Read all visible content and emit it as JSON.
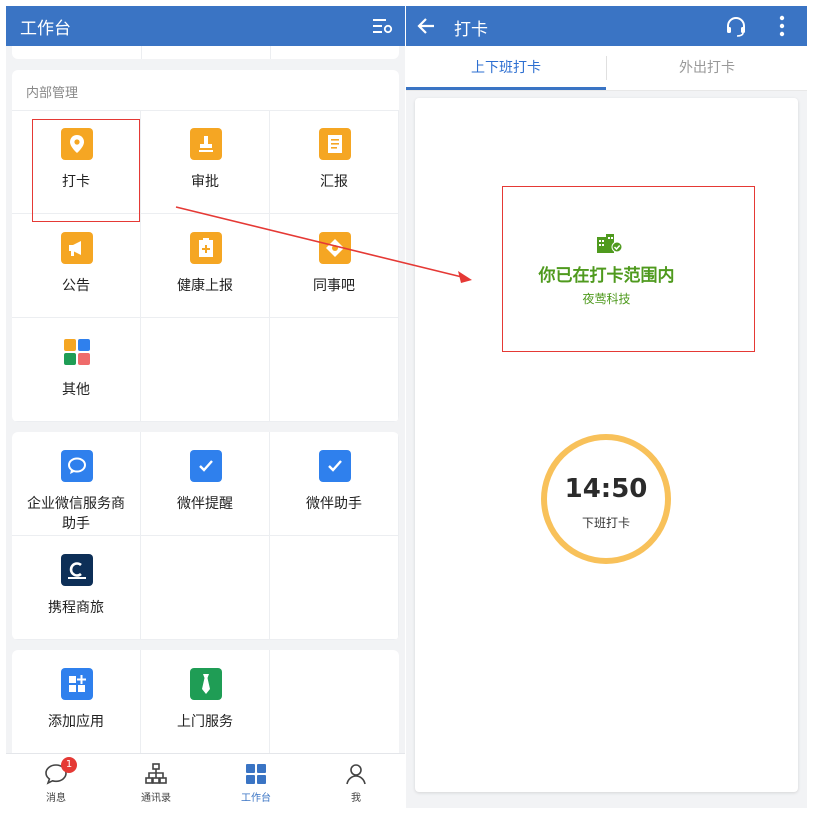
{
  "colors": {
    "primary": "#3a74c4",
    "icon_orange": "#f5a623",
    "icon_blue": "#2f80ed",
    "icon_green": "#1f9d55",
    "success": "#4f9a1e",
    "clock_ring": "#f8c15a",
    "annotation": "#e53935"
  },
  "left": {
    "header": {
      "title": "工作台",
      "right_icon": "filter-settings-icon"
    },
    "sections": [
      {
        "title": "内部管理",
        "items": [
          {
            "label": "打卡",
            "icon": "location-pin-icon"
          },
          {
            "label": "审批",
            "icon": "stamp-icon"
          },
          {
            "label": "汇报",
            "icon": "report-document-icon"
          },
          {
            "label": "公告",
            "icon": "megaphone-icon"
          },
          {
            "label": "健康上报",
            "icon": "health-report-icon"
          },
          {
            "label": "同事吧",
            "icon": "colleague-diamond-icon"
          },
          {
            "label": "其他",
            "icon": "apps-grid-icon"
          }
        ]
      },
      {
        "items": [
          {
            "label": "企业微信服务商助手",
            "icon": "chat-bubble-icon"
          },
          {
            "label": "微伴提醒",
            "icon": "check-badge-icon"
          },
          {
            "label": "微伴助手",
            "icon": "check-badge-icon"
          },
          {
            "label": "携程商旅",
            "icon": "ctrip-logo-icon"
          }
        ]
      },
      {
        "items": [
          {
            "label": "添加应用",
            "icon": "add-app-icon"
          },
          {
            "label": "上门服务",
            "icon": "tie-icon"
          }
        ]
      }
    ],
    "bottom_nav": [
      {
        "label": "消息",
        "icon": "message-bubble-icon",
        "badge": "1"
      },
      {
        "label": "通讯录",
        "icon": "org-chart-icon"
      },
      {
        "label": "工作台",
        "icon": "workbench-grid-icon",
        "active": true
      },
      {
        "label": "我",
        "icon": "person-icon"
      }
    ]
  },
  "right": {
    "header": {
      "title": "打卡",
      "back_icon": "back-arrow-icon",
      "right_icons": [
        "headset-icon",
        "more-vertical-icon"
      ]
    },
    "tabs": [
      {
        "label": "上下班打卡",
        "active": true
      },
      {
        "label": "外出打卡",
        "active": false
      }
    ],
    "status": {
      "icon": "building-check-icon",
      "text": "你已在打卡范围内",
      "company": "夜莺科技"
    },
    "clock": {
      "time": "14:50",
      "label": "下班打卡"
    }
  }
}
